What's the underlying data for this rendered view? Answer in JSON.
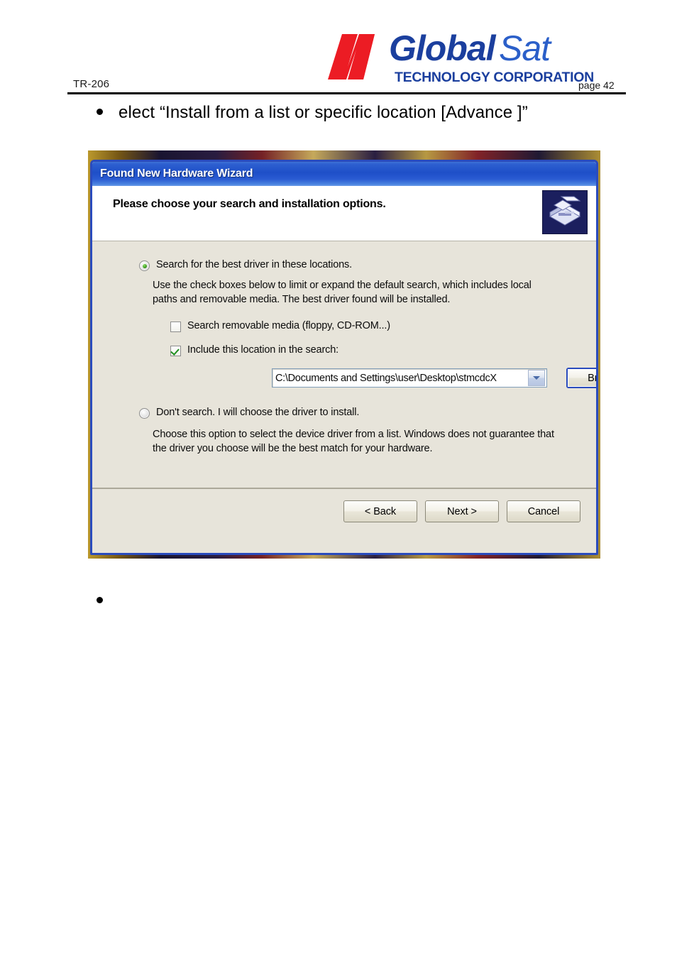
{
  "page": {
    "doc_code": "TR-206",
    "page_label": "page 42",
    "logo": {
      "mark": "globalsat-n-mark",
      "word_primary": "Global",
      "word_secondary": "Sat",
      "tagline": "TECHNOLOGY CORPORATION",
      "color_mark": "#ec1c24",
      "color_primary": "#1b3f9e",
      "color_secondary": "#2b5fc9"
    },
    "bullets": [
      {
        "text": "elect “Install from a list or specific location [Advance  ]”"
      },
      {
        "text": ""
      }
    ]
  },
  "dialog": {
    "title": "Found New Hardware Wizard",
    "header_title": "Please choose your search and installation options.",
    "icon": "hardware-wizard-icon",
    "options": [
      {
        "id": "search-best-driver",
        "label": "Search for the best driver in these locations.",
        "checked": true,
        "description_lines": [
          "Use the check boxes below to limit or expand the default search, which includes local",
          "paths and removable media. The best driver found will be installed."
        ]
      },
      {
        "id": "dont-search",
        "label": "Don't search. I will choose the driver to install.",
        "checked": false,
        "description_lines": [
          "Choose this option to select the device driver from a list.  Windows does not guarantee that",
          "the driver you choose will be the best match for your hardware."
        ]
      }
    ],
    "checkboxes": [
      {
        "id": "search-removable-media",
        "label": "Search removable media (floppy, CD-ROM...)",
        "checked": false
      },
      {
        "id": "include-this-location",
        "label": "Include this location in the search:",
        "checked": true
      }
    ],
    "path_combo": {
      "value": "C:\\Documents and Settings\\user\\Desktop\\stmcdcX",
      "placeholder": "",
      "arrow_icon": "chevron-down-icon"
    },
    "browse_label": "Browse",
    "footer_buttons": [
      {
        "id": "back",
        "label": "< Back"
      },
      {
        "id": "next",
        "label": "Next >"
      },
      {
        "id": "cancel",
        "label": "Cancel"
      }
    ],
    "colors": {
      "titlebar_blue": "#1e4fc8",
      "border_blue": "#2a4bbd",
      "body_beige": "#e7e4da",
      "radio_green": "#3f9e23",
      "check_green": "#1f8f1f"
    }
  }
}
